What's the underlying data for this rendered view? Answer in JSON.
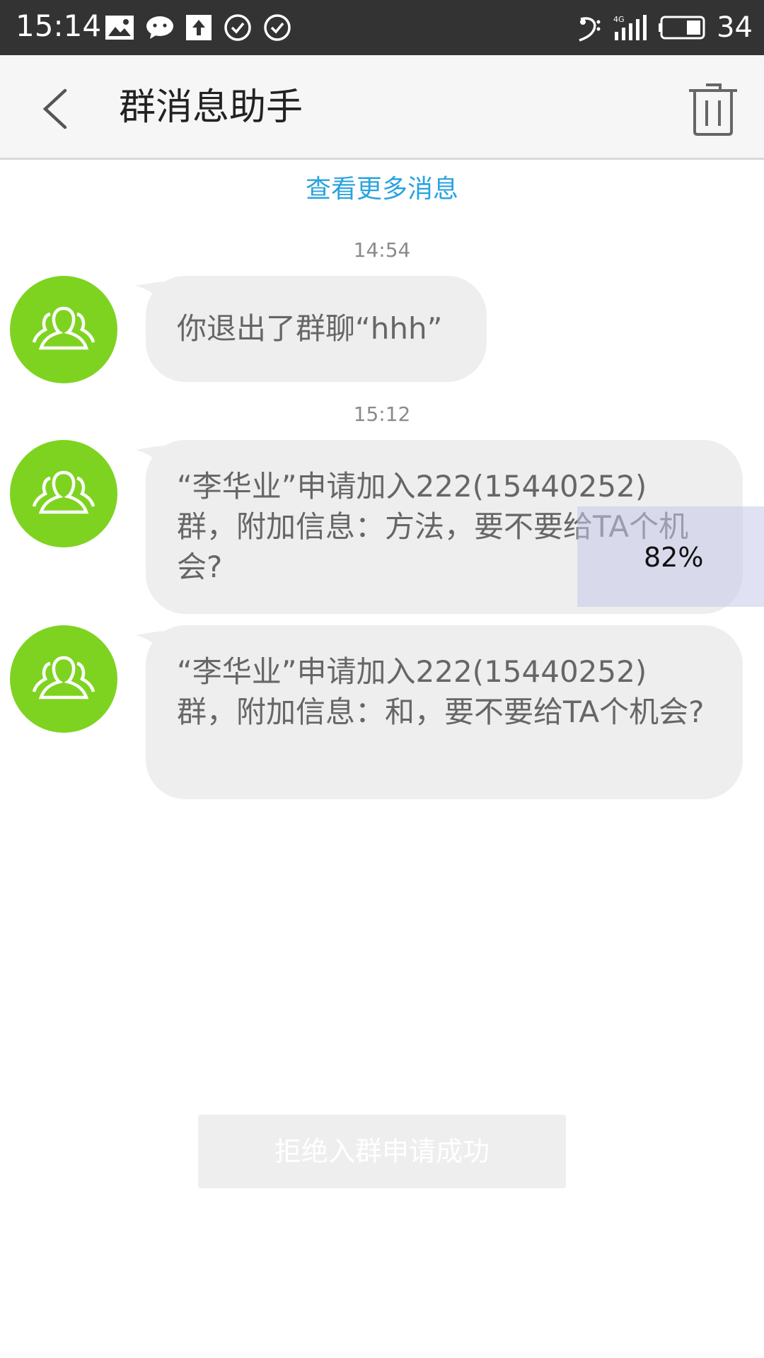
{
  "status_bar": {
    "time": "15:14",
    "battery": "34",
    "left_icons": [
      "image-icon",
      "chat-icon",
      "upload-icon",
      "check-circle-icon",
      "check-circle-icon"
    ],
    "right_icons": [
      "music-clef-icon",
      "4g-signal-icon",
      "battery-icon"
    ]
  },
  "header": {
    "title": "群消息助手"
  },
  "more_link": "查看更多消息",
  "messages": [
    {
      "time": "14:54",
      "text": "你退出了群聊“hhh”"
    },
    {
      "time": "15:12",
      "text": "“李华业”申请加入222(15440252)群，附加信息：方法，要不要给TA个机会?"
    },
    {
      "time": "",
      "text": "“李华业”申请加入222(15440252)群，附加信息：和，要不要给TA个机会?"
    }
  ],
  "overlay": {
    "label": "82%"
  },
  "toast": "拒绝入群申请成功",
  "colors": {
    "status_bar": "#333333",
    "avatar": "#7ed321",
    "link": "#2aa3dd",
    "bubble": "#eeeeee"
  }
}
